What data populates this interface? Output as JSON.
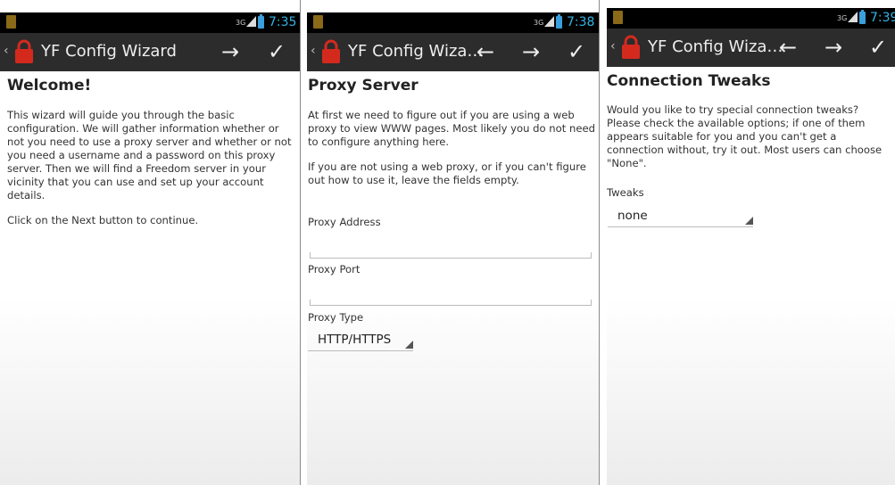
{
  "app": {
    "title": "YF Config Wizard",
    "title_truncated": "YF Config Wiza…"
  },
  "icons": {
    "up": "chevron-left-icon",
    "app": "lock-icon",
    "next": "arrow-right-icon",
    "back": "arrow-left-icon",
    "finish": "checkmark-icon"
  },
  "colors": {
    "clock": "#33b5e5",
    "action_bar": "#2c2c2c",
    "status_bar": "#000000",
    "app_icon": "#d42a1e"
  },
  "panels": [
    {
      "status": {
        "network": "3G",
        "time": "7:35"
      },
      "heading": "Welcome!",
      "paragraphs": [
        "This wizard will guide you through the basic configuration. We will gather information whether or not you need to use a proxy server and whether or not you need a username and a password on this proxy server. Then we will find a Freedom server in your vicinity that you can use and set up your account details.",
        "Click on the Next button to continue."
      ]
    },
    {
      "status": {
        "network": "3G",
        "time": "7:38"
      },
      "heading": "Proxy Server",
      "paragraphs": [
        "At first we need to figure out if you are using a web proxy to view WWW pages. Most likely you do not need to configure anything here.",
        "If you are not using a web proxy, or if you can't figure out how to use it, leave the fields empty."
      ],
      "proxy_address_label": "Proxy Address",
      "proxy_address_value": "",
      "proxy_port_label": "Proxy Port",
      "proxy_port_value": "",
      "proxy_type_label": "Proxy Type",
      "proxy_type_value": "HTTP/HTTPS"
    },
    {
      "status": {
        "network": "3G",
        "time": "7:39"
      },
      "heading": "Connection Tweaks",
      "paragraphs": [
        "Would you like to try special connection tweaks? Please check the available options; if one of them appears suitable for you and you can't get a connection without, try it out. Most users can choose \"None\"."
      ],
      "tweaks_label": "Tweaks",
      "tweaks_value": "none"
    }
  ]
}
